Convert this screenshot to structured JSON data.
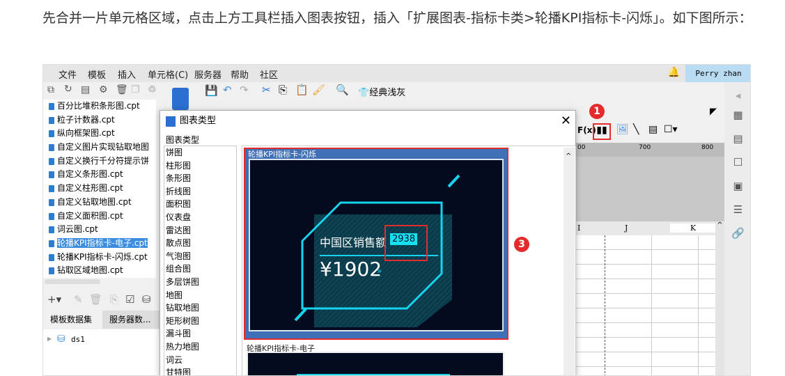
{
  "intro_text": "先合并一片单元格区域，点击上方工具栏插入图表按钮，插入「扩展图表-指标卡类>轮播KPI指标卡-闪烁」。如下图所示：",
  "menubar": {
    "items": [
      "文件",
      "模板",
      "插入",
      "单元格(C)",
      "服务器",
      "帮助",
      "社区"
    ],
    "user": "Perry zhan"
  },
  "toolbar": {
    "theme_label": "经典浅灰"
  },
  "file_tree": [
    "百分比堆积条形图.cpt",
    "粒子计数器.cpt",
    "纵向框架图.cpt",
    "自定义图片实现钻取地图",
    "自定义换行千分符提示饼",
    "自定义条形图.cpt",
    "自定义柱形图.cpt",
    "自定义钻取地图.cpt",
    "自定义面积图.cpt",
    "词云图.cpt",
    "轮播KPI指标卡-电子.cpt",
    "轮播KPI指标卡-闪烁.cpt",
    "钻取区域地图.cpt"
  ],
  "selected_file_index": 10,
  "dataset_tabs": [
    "模板数据集",
    "服务器数..."
  ],
  "datasets": [
    "ds1"
  ],
  "dialog": {
    "title": "图表类型",
    "section_label": "图表类型",
    "chart_types": [
      "饼图",
      "柱形图",
      "条形图",
      "折线图",
      "面积图",
      "仪表盘",
      "雷达图",
      "散点图",
      "气泡图",
      "组合图",
      "多层饼图",
      "地图",
      "钻取地图",
      "矩形树图",
      "漏斗图",
      "热力地图",
      "词云",
      "甘特图"
    ],
    "cards": [
      {
        "caption": "轮播KPI指标卡-闪烁",
        "kpi_label": "中国区销售额",
        "kpi_badge": "2938",
        "kpi_value": "¥1902"
      },
      {
        "caption": "轮播KPI指标卡-电子"
      }
    ]
  },
  "ruler": [
    "700",
    "800"
  ],
  "ruler_partial": "00",
  "columns": [
    "I",
    "J",
    "K"
  ],
  "badges": {
    "step1": "1",
    "step3": "3"
  }
}
